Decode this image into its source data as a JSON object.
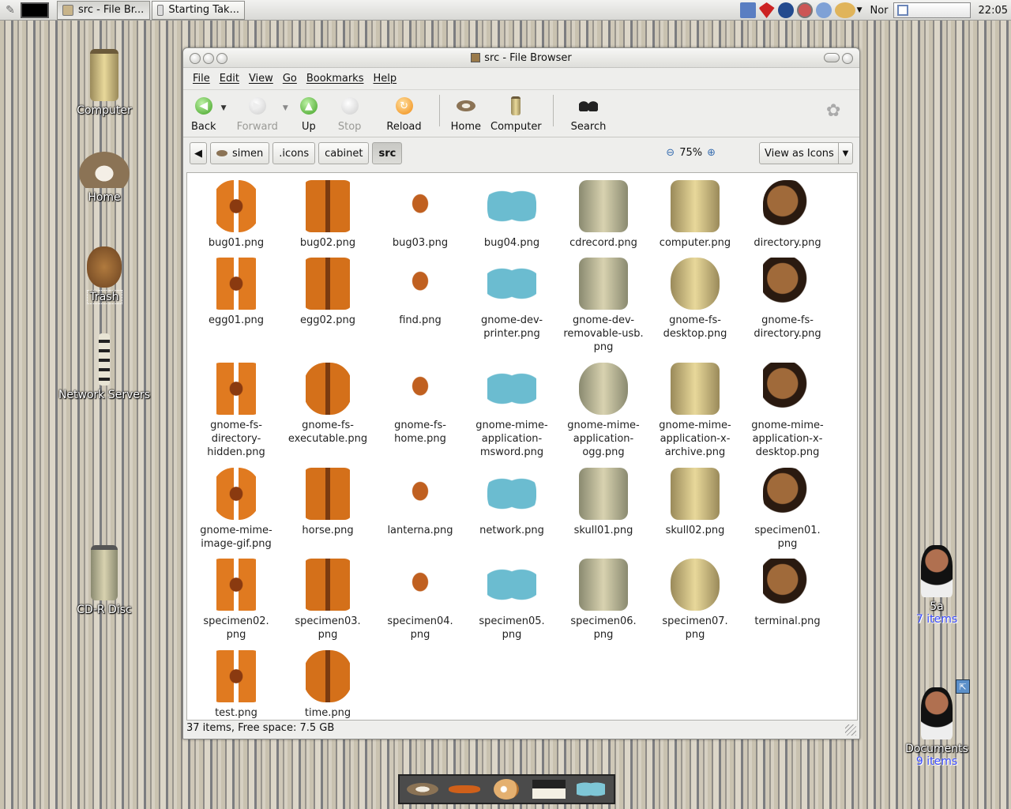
{
  "panel": {
    "tasks": [
      {
        "label": "src - File Br..."
      },
      {
        "label": "Starting Tak..."
      }
    ],
    "keyboard_layout": "Nor",
    "clock": "22:05"
  },
  "desktop": {
    "icons": [
      {
        "label": "Computer"
      },
      {
        "label": "Home"
      },
      {
        "label": "Trash"
      },
      {
        "label": "Network Servers"
      },
      {
        "label": "CD-R Disc"
      }
    ],
    "right_icons": [
      {
        "label": "5a",
        "sub": "7 items"
      },
      {
        "label": "Documents",
        "sub": "9 items"
      }
    ]
  },
  "window": {
    "title": "src - File Browser",
    "menu": [
      "File",
      "Edit",
      "View",
      "Go",
      "Bookmarks",
      "Help"
    ],
    "toolbar": {
      "back": "Back",
      "forward": "Forward",
      "up": "Up",
      "stop": "Stop",
      "reload": "Reload",
      "home": "Home",
      "computer": "Computer",
      "search": "Search"
    },
    "breadcrumbs": [
      "simen",
      ".icons",
      "cabinet",
      "src"
    ],
    "zoom": "75%",
    "view_mode": "View as Icons",
    "status": "37 items, Free space: 7.5 GB"
  },
  "files": [
    [
      "bug01.png"
    ],
    [
      "bug02.png"
    ],
    [
      "bug03.png"
    ],
    [
      "bug04.png"
    ],
    [
      "cdrecord.png"
    ],
    [
      "computer.png"
    ],
    [
      "directory.png"
    ],
    [
      "egg01.png"
    ],
    [
      "egg02.png"
    ],
    [
      "find.png"
    ],
    [
      "gnome-dev-",
      "printer.png"
    ],
    [
      "gnome-dev-",
      "removable-usb.",
      "png"
    ],
    [
      "gnome-fs-",
      "desktop.png"
    ],
    [
      "gnome-fs-",
      "directory.png"
    ],
    [
      "gnome-fs-",
      "directory-",
      "hidden.png"
    ],
    [
      "gnome-fs-",
      "executable.png"
    ],
    [
      "gnome-fs-",
      "home.png"
    ],
    [
      "gnome-mime-",
      "application-",
      "msword.png"
    ],
    [
      "gnome-mime-",
      "application-",
      "ogg.png"
    ],
    [
      "gnome-mime-",
      "application-x-",
      "archive.png"
    ],
    [
      "gnome-mime-",
      "application-x-",
      "desktop.png"
    ],
    [
      "gnome-mime-",
      "image-gif.png"
    ],
    [
      "horse.png"
    ],
    [
      "lanterna.png"
    ],
    [
      "network.png"
    ],
    [
      "skull01.png"
    ],
    [
      "skull02.png"
    ],
    [
      "specimen01.",
      "png"
    ],
    [
      "specimen02.",
      "png"
    ],
    [
      "specimen03.",
      "png"
    ],
    [
      "specimen04.",
      "png"
    ],
    [
      "specimen05.",
      "png"
    ],
    [
      "specimen06.",
      "png"
    ],
    [
      "specimen07.",
      "png"
    ],
    [
      "terminal.png"
    ],
    [
      "test.png"
    ],
    [
      "time.png"
    ]
  ],
  "colors": {
    "window_bg": "#eeeeec",
    "desktop_stripe_light": "#d6d0c2",
    "desktop_stripe_dark": "#7c7d80",
    "subtitle_blue": "#3b4cff"
  }
}
